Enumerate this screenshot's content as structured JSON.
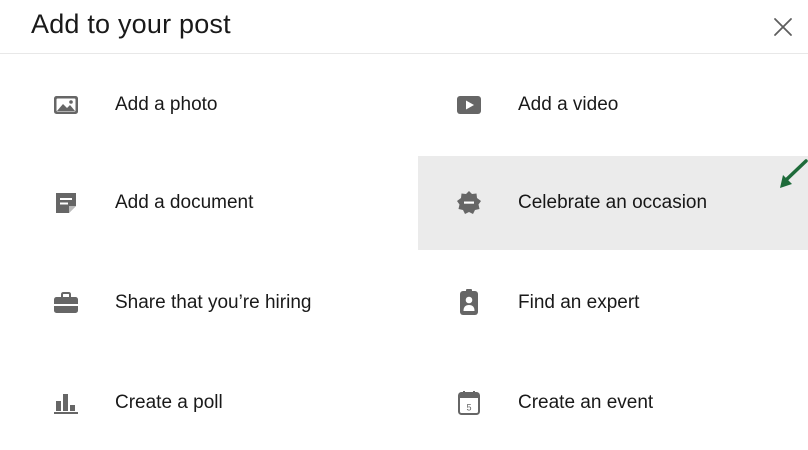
{
  "header": {
    "title": "Add to your post",
    "close_icon": "close-icon"
  },
  "options": {
    "add_photo": {
      "label": "Add a photo",
      "icon": "photo-icon"
    },
    "add_video": {
      "label": "Add a video",
      "icon": "video-icon"
    },
    "add_document": {
      "label": "Add a document",
      "icon": "document-icon"
    },
    "celebrate": {
      "label": "Celebrate an occasion",
      "icon": "badge-icon"
    },
    "hiring": {
      "label": "Share that you’re hiring",
      "icon": "briefcase-icon"
    },
    "find_expert": {
      "label": "Find an expert",
      "icon": "person-badge-icon"
    },
    "poll": {
      "label": "Create a poll",
      "icon": "poll-icon"
    },
    "event": {
      "label": "Create an event",
      "icon": "calendar-icon",
      "calendar_day": "5"
    }
  },
  "colors": {
    "icon": "#666666",
    "highlight": "#ebebeb",
    "annotation_arrow": "#1e6b3a"
  }
}
